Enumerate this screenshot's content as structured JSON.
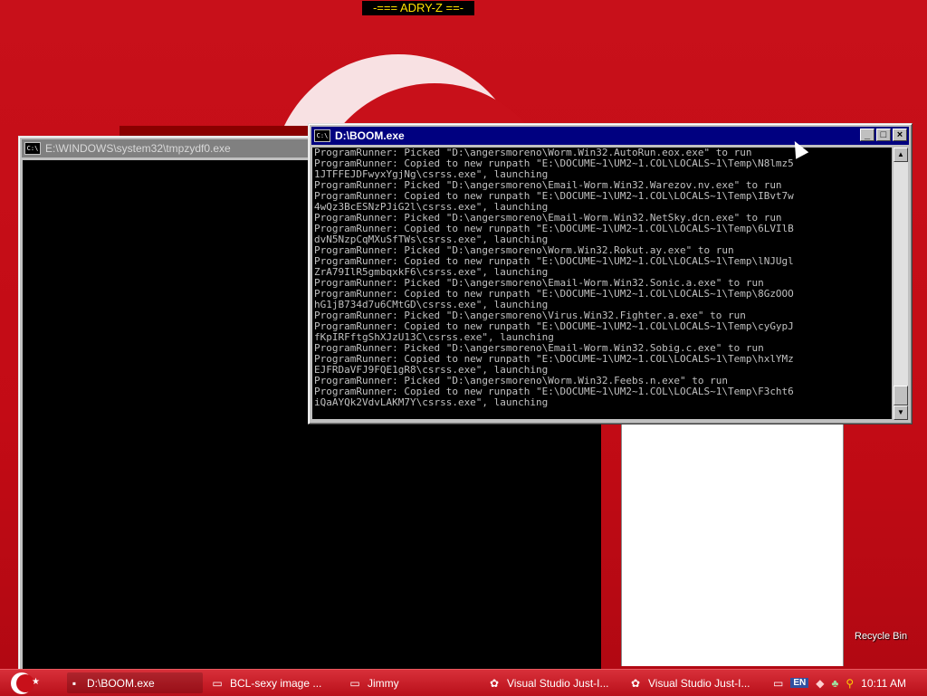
{
  "desktop": {
    "banner": "-=== ADRY-Z ==-",
    "recycle_bin_label": "Recycle Bin"
  },
  "window_back": {
    "title": "E:\\WINDOWS\\system32\\tmpzydf0.exe",
    "icon": "console-icon"
  },
  "window_front": {
    "title": "D:\\BOOM.exe",
    "icon": "console-icon",
    "buttons": {
      "minimize": "_",
      "maximize": "□",
      "close": "×"
    },
    "lines": [
      "ProgramRunner: Picked \"D:\\angersmoreno\\Worm.Win32.AutoRun.eox.exe\" to run",
      "ProgramRunner: Copied to new runpath \"E:\\DOCUME~1\\UM2~1.COL\\LOCALS~1\\Temp\\N8lmz5",
      "1JTFFEJDFwyxYgjNg\\csrss.exe\", launching",
      "ProgramRunner: Picked \"D:\\angersmoreno\\Email-Worm.Win32.Warezov.nv.exe\" to run",
      "ProgramRunner: Copied to new runpath \"E:\\DOCUME~1\\UM2~1.COL\\LOCALS~1\\Temp\\IBvt7w",
      "4wQz3BcESNzPJiG2l\\csrss.exe\", launching",
      "ProgramRunner: Picked \"D:\\angersmoreno\\Email-Worm.Win32.NetSky.dcn.exe\" to run",
      "ProgramRunner: Copied to new runpath \"E:\\DOCUME~1\\UM2~1.COL\\LOCALS~1\\Temp\\6LVIlB",
      "dvN5NzpCqMXuSfTWs\\csrss.exe\", launching",
      "ProgramRunner: Picked \"D:\\angersmoreno\\Worm.Win32.Rokut.ay.exe\" to run",
      "ProgramRunner: Copied to new runpath \"E:\\DOCUME~1\\UM2~1.COL\\LOCALS~1\\Temp\\lNJUgl",
      "ZrA79IlR5gmbqxkF6\\csrss.exe\", launching",
      "ProgramRunner: Picked \"D:\\angersmoreno\\Email-Worm.Win32.Sonic.a.exe\" to run",
      "ProgramRunner: Copied to new runpath \"E:\\DOCUME~1\\UM2~1.COL\\LOCALS~1\\Temp\\8GzOOO",
      "hG1jB734d7u6CMtGD\\csrss.exe\", launching",
      "ProgramRunner: Picked \"D:\\angersmoreno\\Virus.Win32.Fighter.a.exe\" to run",
      "ProgramRunner: Copied to new runpath \"E:\\DOCUME~1\\UM2~1.COL\\LOCALS~1\\Temp\\cyGypJ",
      "fKpIRFftgShXJzU13C\\csrss.exe\", launching",
      "ProgramRunner: Picked \"D:\\angersmoreno\\Email-Worm.Win32.Sobig.c.exe\" to run",
      "ProgramRunner: Copied to new runpath \"E:\\DOCUME~1\\UM2~1.COL\\LOCALS~1\\Temp\\hxlYMz",
      "EJFRDaVFJ9FQE1gR8\\csrss.exe\", launching",
      "ProgramRunner: Picked \"D:\\angersmoreno\\Worm.Win32.Feebs.n.exe\" to run",
      "ProgramRunner: Copied to new runpath \"E:\\DOCUME~1\\UM2~1.COL\\LOCALS~1\\Temp\\F3cht6",
      "iQaAYQk2VdvLAKM7Y\\csrss.exe\", launching"
    ]
  },
  "taskbar": {
    "tasks": [
      {
        "label": "D:\\BOOM.exe",
        "icon": "console-icon",
        "active": true
      },
      {
        "label": "BCL-sexy image ...",
        "icon": "folder-icon",
        "active": false
      },
      {
        "label": "Jimmy",
        "icon": "folder-icon",
        "active": false
      },
      {
        "label": "Visual Studio Just-I...",
        "icon": "debugger-icon",
        "active": false
      },
      {
        "label": "Visual Studio Just-I...",
        "icon": "debugger-icon",
        "active": false
      }
    ],
    "tray": {
      "language": "EN",
      "clock": "10:11 AM"
    }
  }
}
